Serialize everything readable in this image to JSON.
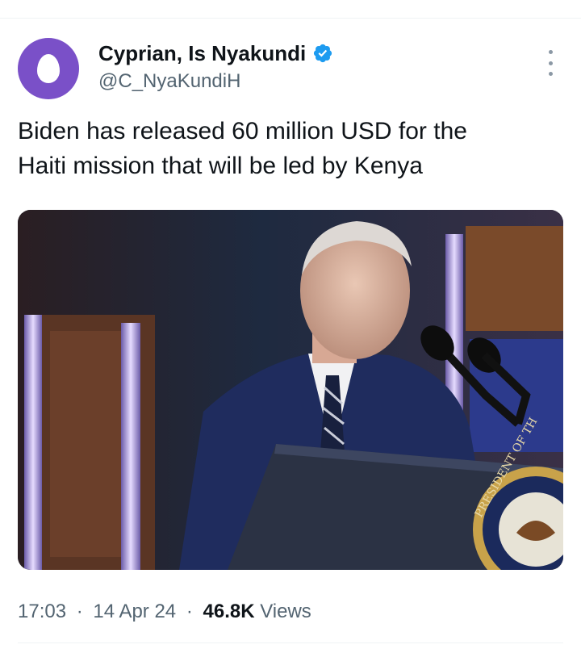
{
  "author": {
    "display_name": "Cyprian, Is Nyakundi",
    "handle": "@C_NyaKundiH",
    "verified": true,
    "avatar_color": "#7a50c8",
    "verified_color": "#1d9bf0"
  },
  "tweet": {
    "text": "Biden has released 60 million USD for the\nHaiti mission that will be led by Kenya",
    "media": {
      "seal_text": "PRESIDENT OF TH"
    }
  },
  "meta": {
    "time": "17:03",
    "separator": "·",
    "date": "14 Apr 24",
    "views_count": "46.8K",
    "views_label": "Views"
  },
  "icons": {
    "more": "more-vertical-icon",
    "verified": "verified-badge-icon",
    "avatar": "default-egg-avatar-icon"
  }
}
